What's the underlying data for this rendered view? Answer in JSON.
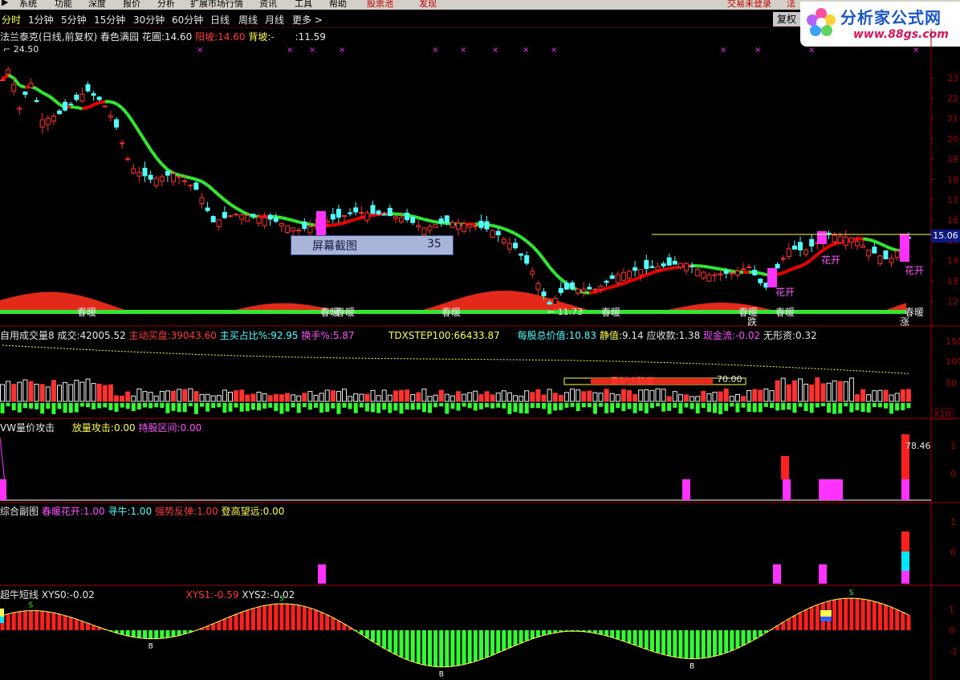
{
  "menu": {
    "items": [
      "系统",
      "功能",
      "深度",
      "报价",
      "分析",
      "扩展市场行情",
      "资讯",
      "工具",
      "帮助",
      "股票池",
      "发现"
    ],
    "right_text": "交易未登录",
    "right_text2": "法"
  },
  "periods": [
    "分时",
    "1分钟",
    "5分钟",
    "15分钟",
    "30分钟",
    "60分钟",
    "日线",
    "周线",
    "月线",
    "更多 >"
  ],
  "active_period": "分时",
  "restore_label": "复权",
  "logo": {
    "title": "分析家公式网",
    "url": "www.88gs.com"
  },
  "main_title": {
    "stock": "法兰泰克(日线,前复权)",
    "indicator": "春色满园",
    "huapu_label": "花圃:",
    "huapu_value": "14.60",
    "yangpo_label": "阳坡:",
    "yangpo_value": "14.60",
    "beipo_label": "背坡:",
    "beipo_value": "-",
    "extra_value": ":11.59"
  },
  "main_chart": {
    "high_label": "24.50",
    "low_label": "11.73",
    "price_tag": "15.06",
    "y_ticks": [
      "23",
      "22",
      "21",
      "20",
      "19",
      "18",
      "17",
      "16",
      "15",
      "14",
      "13",
      "12"
    ],
    "labels_chunnuan": [
      "春暖",
      "春暖",
      "春暖",
      "春暖",
      "春暖",
      "春暖",
      "春暖",
      "春暖"
    ],
    "labels_huakai": [
      "花开",
      "花开",
      "花开"
    ],
    "label_die": "跌",
    "label_zhang": "涨",
    "screenshot_label": "屏幕截图",
    "screenshot_value": "35"
  },
  "volume_panel": {
    "name": "自用成交量8",
    "vol_label": "成交:",
    "vol_value": "42005.52",
    "main_buy_label": "主动买盘:",
    "main_buy_value": "39043.60",
    "main_ratio_label": "主买占比%:",
    "main_ratio_value": "92.95",
    "turnover_label": "换手%:",
    "turnover_value": "5.87",
    "tdx_label": "TDXSTEP100:",
    "tdx_value": "66433.87",
    "nav_label": "每股总价值:",
    "nav_value": "10.83",
    "static_label": "静值:",
    "static_value": "9.14",
    "receivable_label": "应收款:",
    "receivable_value": "1.38",
    "cash_label": "现金流:",
    "cash_value": "-0.02",
    "intangible_label": "无形资:",
    "intangible_value": "0.32",
    "y_ticks": [
      "150",
      "100",
      "50"
    ],
    "saturation_label": "量能饱和度",
    "saturation_value": "70.00",
    "x10": "X10"
  },
  "attack_panel": {
    "name": "VW量价攻击",
    "fl_label": "放量攻击:",
    "fl_value": "0.00",
    "cg_label": "持股区间:",
    "cg_value": "0.00",
    "top_value": "78.46",
    "y_ticks": [
      "1",
      "0"
    ]
  },
  "combo_panel": {
    "name": "综合副图",
    "chnk_label": "春暖花开:",
    "chnk_value": "1.00",
    "xn_label": "寻牛:",
    "xn_value": "1.00",
    "qs_label": "强势反弹:",
    "qs_value": "1.00",
    "dg_label": "登高望远:",
    "dg_value": "0.00",
    "y_ticks": [
      "1",
      "0"
    ]
  },
  "bull_panel": {
    "name": "超牛短线",
    "xys0_label": "XYS0:",
    "xys0_value": "-0.02",
    "xys1_label": "XYS1:",
    "xys1_value": "-0.59",
    "xys2_label": "XYS2:",
    "xys2_value": "-0.02",
    "y_ticks": [
      "1",
      "0",
      "-1"
    ]
  },
  "colors": {
    "up": "#ff3232",
    "down": "#54ffff",
    "ma_down": "#32e632",
    "ma_up": "#e60000",
    "magenta": "#ff32ff",
    "green_bar": "#32ff32",
    "axis": "#a00000"
  }
}
